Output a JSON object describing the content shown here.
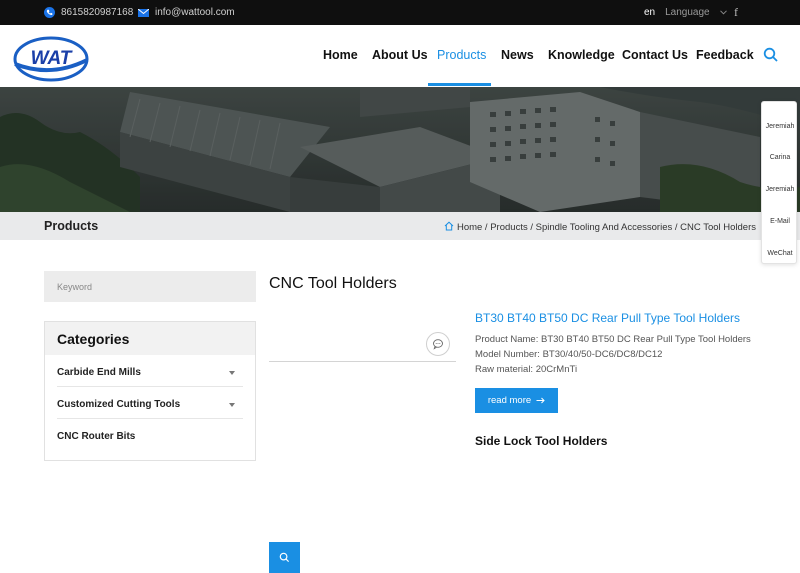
{
  "topbar": {
    "phone": "8615820987168",
    "email": "info@wattool.com",
    "lang_code": "en",
    "lang_label": "Language",
    "facebook_glyph": "f"
  },
  "logo": {
    "text": "WAT"
  },
  "nav": {
    "items": [
      "Home",
      "About Us",
      "Products",
      "News",
      "Knowledge",
      "Contact Us",
      "Feedback"
    ],
    "active": "Products"
  },
  "breadcrumb_bar": {
    "page_title": "Products",
    "trail": "Home / Products / Spindle Tooling And Accessories / CNC Tool Holders"
  },
  "float_contacts": [
    "Jeremiah",
    "Carina",
    "Jeremiah",
    "E-Mail",
    "WeChat"
  ],
  "sidebar": {
    "search_placeholder": "Keyword",
    "categories_title": "Categories",
    "categories": [
      "Carbide End Mills",
      "Customized Cutting Tools",
      "CNC Router Bits"
    ]
  },
  "main": {
    "title": "CNC Tool Holders",
    "product": {
      "title": "BT30 BT40 BT50 DC Rear Pull Type Tool Holders",
      "name_line": "Product Name: BT30 BT40 BT50 DC Rear Pull Type Tool Holders",
      "model_line": "Model Number: BT30/40/50-DC6/DC8/DC12",
      "material_line": "Raw material: 20CrMnTi",
      "read_more": "read more"
    },
    "product2": {
      "title": "Side Lock Tool Holders"
    }
  },
  "colors": {
    "accent": "#1a8fe3",
    "topbar": "#0f0f0f",
    "crumb_bg": "#e9eaeb"
  },
  "icons": [
    "phone-icon",
    "mail-icon",
    "chevron-down-icon",
    "facebook-icon",
    "search-icon",
    "home-icon",
    "chat-icon",
    "arrow-right-icon"
  ]
}
